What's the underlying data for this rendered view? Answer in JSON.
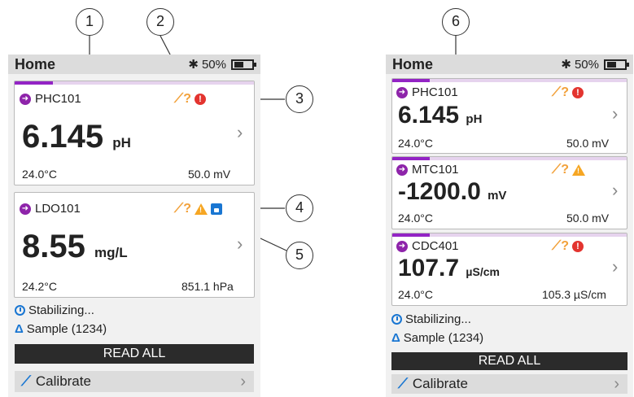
{
  "callouts": [
    "1",
    "2",
    "3",
    "4",
    "5",
    "6"
  ],
  "left": {
    "title": "Home",
    "bluetooth": "✱",
    "battery": "50%",
    "cards": [
      {
        "probe": "PHC101",
        "progress": 0.16,
        "value": "6.145",
        "unit": "pH",
        "temp": "24.0°C",
        "secondary": "50.0 mV",
        "icons": [
          "calibration-due-icon",
          "error-icon"
        ]
      },
      {
        "probe": "LDO101",
        "progress": 0,
        "value": "8.55",
        "unit": "mg/L",
        "temp": "24.2°C",
        "secondary": "851.1 hPa",
        "icons": [
          "calibration-due-icon",
          "warning-icon",
          "save-icon"
        ]
      }
    ],
    "status": "Stabilizing...",
    "sample": "Sample (1234)",
    "read_all": "READ ALL",
    "calibrate": "Calibrate"
  },
  "right": {
    "title": "Home",
    "bluetooth": "✱",
    "battery": "50%",
    "cards": [
      {
        "probe": "PHC101",
        "progress": 0.16,
        "value": "6.145",
        "unit": "pH",
        "temp": "24.0°C",
        "secondary": "50.0 mV",
        "icons": [
          "calibration-due-icon",
          "error-icon"
        ]
      },
      {
        "probe": "MTC101",
        "progress": 0.16,
        "value": "-1200.0",
        "unit": "mV",
        "temp": "24.0°C",
        "secondary": "50.0 mV",
        "icons": [
          "calibration-due-icon",
          "warning-icon"
        ]
      },
      {
        "probe": "CDC401",
        "progress": 0.16,
        "value": "107.7",
        "unit": "µS/cm",
        "temp": "24.0°C",
        "secondary": "105.3 µS/cm",
        "icons": [
          "calibration-due-icon",
          "error-icon"
        ]
      }
    ],
    "status": "Stabilizing...",
    "sample": "Sample (1234)",
    "read_all": "READ ALL",
    "calibrate": "Calibrate"
  },
  "colors": {
    "accent": "#9324c5",
    "calibrate": "#f2a13a",
    "error": "#e3342f",
    "warning": "#f6a623",
    "info": "#1976d2"
  }
}
